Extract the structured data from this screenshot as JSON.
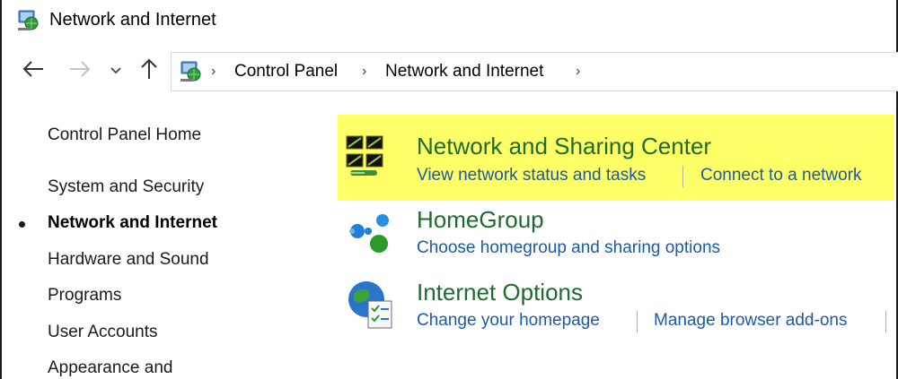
{
  "window": {
    "title": "Network and Internet",
    "title_icon": "network-internet-icon"
  },
  "nav": {
    "back_icon": "back-arrow-icon",
    "forward_icon": "forward-arrow-icon",
    "recent_icon": "chevron-down-icon",
    "up_icon": "up-arrow-icon",
    "breadcrumb": [
      "Control Panel",
      "Network and Internet"
    ]
  },
  "sidebar": {
    "items": [
      {
        "label": "Control Panel Home",
        "active": false
      },
      {
        "label": "System and Security",
        "active": false
      },
      {
        "label": "Network and Internet",
        "active": true
      },
      {
        "label": "Hardware and Sound",
        "active": false
      },
      {
        "label": "Programs",
        "active": false
      },
      {
        "label": "User Accounts",
        "active": false
      },
      {
        "label": "Appearance and",
        "active": false
      }
    ]
  },
  "main": {
    "categories": [
      {
        "title": "Network and Sharing Center",
        "icon": "network-sharing-center-icon",
        "highlighted": true,
        "links": [
          "View network status and tasks",
          "Connect to a network"
        ]
      },
      {
        "title": "HomeGroup",
        "icon": "homegroup-icon",
        "highlighted": false,
        "links": [
          "Choose homegroup and sharing options"
        ]
      },
      {
        "title": "Internet Options",
        "icon": "internet-options-icon",
        "highlighted": false,
        "links": [
          "Change your homepage",
          "Manage browser add-ons"
        ]
      }
    ]
  },
  "colors": {
    "highlight": "#ffff66",
    "category_title": "#1e6b2e",
    "link": "#1c5aa6"
  }
}
